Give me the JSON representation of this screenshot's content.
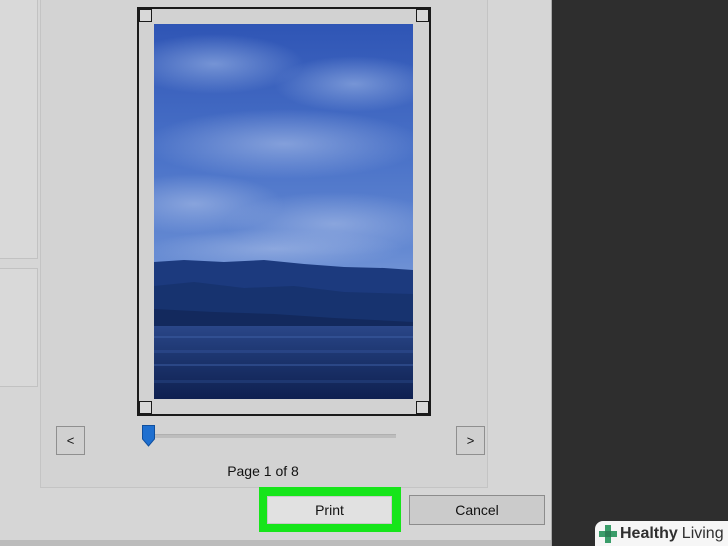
{
  "preview": {
    "page_indicator": "Page 1 of 8",
    "prev_label": "<",
    "next_label": ">",
    "current_page": 1,
    "total_pages": 8
  },
  "actions": {
    "print_label": "Print",
    "cancel_label": "Cancel"
  },
  "colors": {
    "highlight": "#16e51a",
    "slider_thumb": "#1e6fd0",
    "dialog_bg": "#d6d6d6",
    "desktop_bg": "#2e2e2e"
  },
  "watermark": {
    "brand_bold": "Healthy",
    "brand_light": "Living"
  }
}
